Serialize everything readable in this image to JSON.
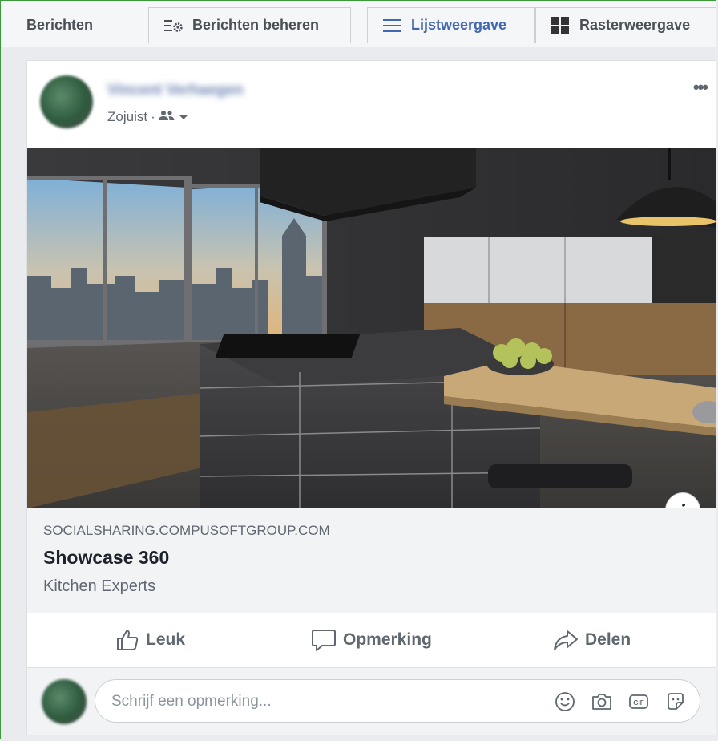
{
  "tabs": {
    "title": "Berichten",
    "manage_label": "Berichten beheren",
    "list_label": "Lijstweergave",
    "grid_label": "Rasterweergave"
  },
  "post": {
    "author": "Vincent Verhaegen",
    "time": "Zojuist",
    "separator": "·",
    "more_icon": "more-horizontal-icon",
    "privacy_icon": "friends-icon"
  },
  "link_preview": {
    "domain": "SOCIALSHARING.COMPUSOFTGROUP.COM",
    "title": "Showcase 360",
    "description": "Kitchen Experts"
  },
  "actions": {
    "like_label": "Leuk",
    "comment_label": "Opmerking",
    "share_label": "Delen"
  },
  "composer": {
    "placeholder": "Schrijf een opmerking...",
    "icons": [
      "emoji-icon",
      "camera-icon",
      "gif-icon",
      "sticker-icon"
    ]
  },
  "colors": {
    "accent": "#4267b2",
    "frame_border": "#3a9a3a",
    "background": "#e9ebee"
  }
}
